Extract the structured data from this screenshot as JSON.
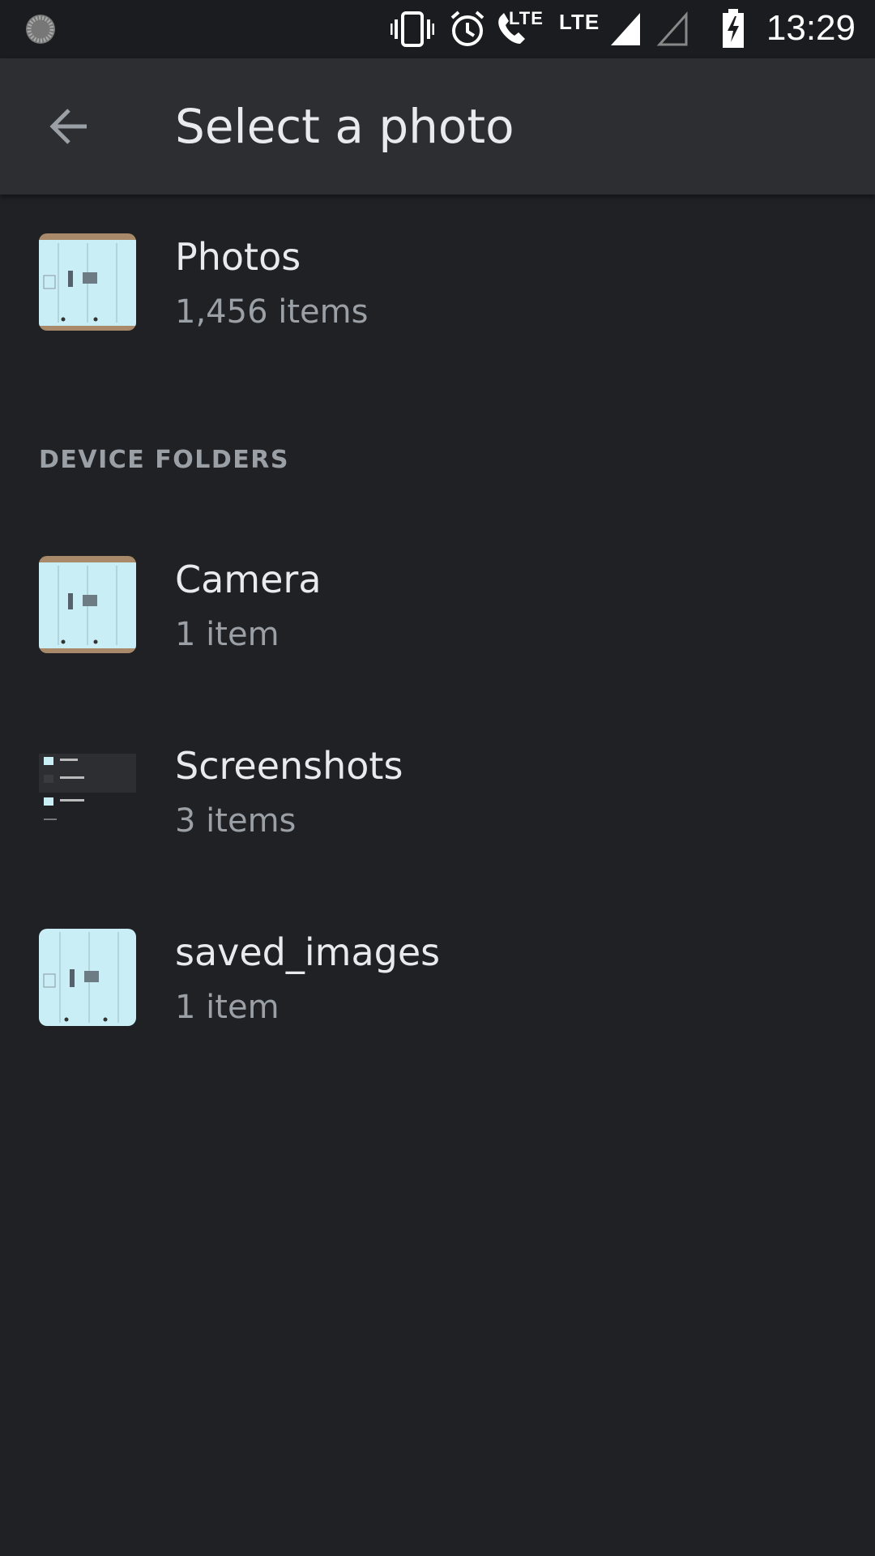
{
  "status_bar": {
    "time": "13:29",
    "lte_1": "LTE",
    "lte_2": "LTE",
    "icons": [
      "loading-circle-icon",
      "vibrate-icon",
      "alarm-icon",
      "wifi-calling-icon",
      "signal-full-icon",
      "signal-empty-icon",
      "battery-charging-icon"
    ]
  },
  "app_bar": {
    "title": "Select a photo",
    "back_icon": "arrow-back-icon"
  },
  "albums": {
    "photos": {
      "name": "Photos",
      "count": "1,456 items"
    }
  },
  "device_folders": {
    "header": "DEVICE FOLDERS",
    "items": [
      {
        "name": "Camera",
        "count": "1 item"
      },
      {
        "name": "Screenshots",
        "count": "3 items"
      },
      {
        "name": "saved_images",
        "count": "1 item"
      }
    ]
  },
  "colors": {
    "background": "#202124",
    "app_bar": "#2d2e31",
    "status_bar": "#1b1c1f",
    "primary_text": "#e8eaed",
    "secondary_text": "#9aa0a6"
  }
}
